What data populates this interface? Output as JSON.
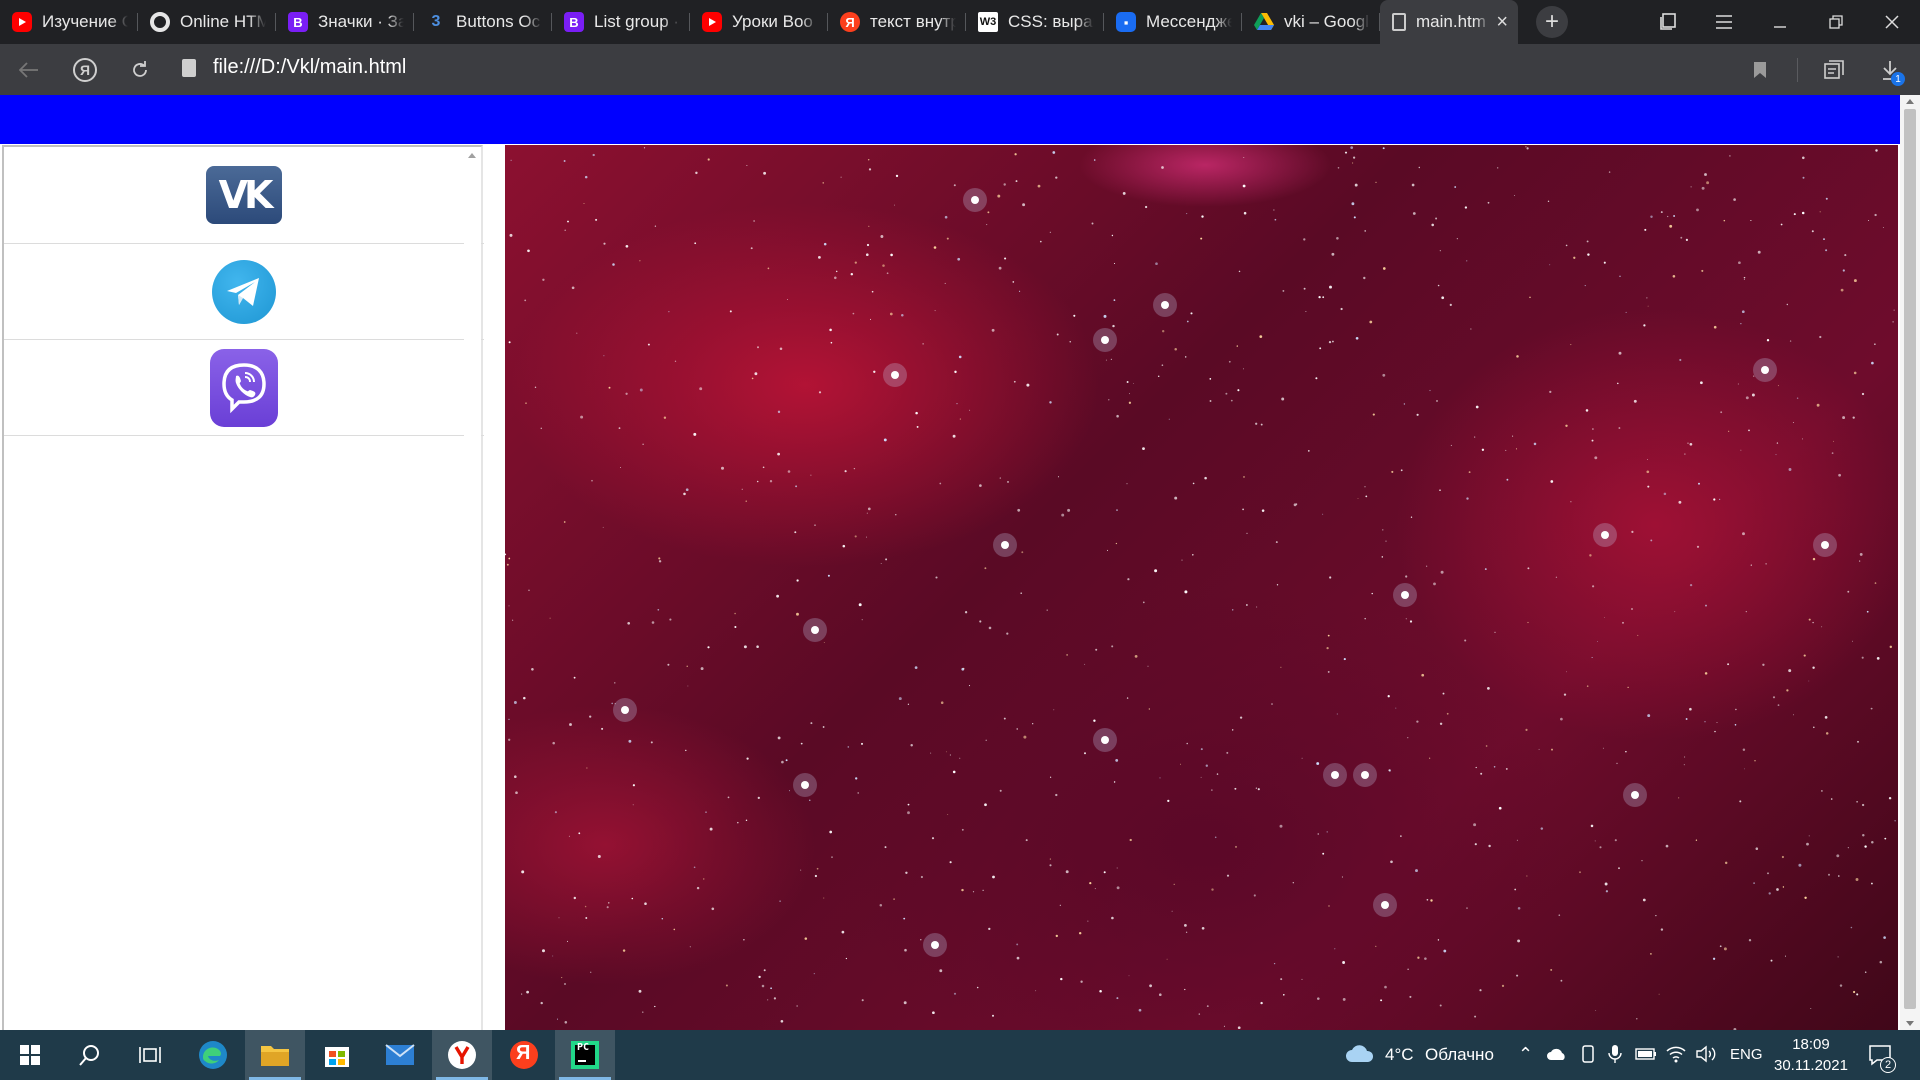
{
  "browser": {
    "tabs": [
      {
        "title": "Изучение С",
        "favicon": "youtube-icon"
      },
      {
        "title": "Online HTM",
        "favicon": "html-editor-icon"
      },
      {
        "title": "Значки · За",
        "favicon": "bootstrap-icon"
      },
      {
        "title": "Buttons Oc",
        "favicon": "css3-icon"
      },
      {
        "title": "List group ·",
        "favicon": "bootstrap-icon"
      },
      {
        "title": "Уроки Boo",
        "favicon": "youtube-icon"
      },
      {
        "title": "текст внутр",
        "favicon": "yandex-icon"
      },
      {
        "title": "CSS: вырав",
        "favicon": "w3schools-icon"
      },
      {
        "title": "Мессендже",
        "favicon": "messenger-icon"
      },
      {
        "title": "vki – Googl",
        "favicon": "google-drive-icon"
      },
      {
        "title": "main.htm",
        "favicon": "file-icon",
        "active": true
      }
    ],
    "new_tab_symbol": "+",
    "address": "file:///D:/Vkl/main.html",
    "download_badge": "1",
    "yandex_button_letter": "Я"
  },
  "page": {
    "header_color": "#0000ff",
    "social_list": [
      {
        "name": "vk",
        "glyph": "VK"
      },
      {
        "name": "telegram",
        "glyph": ""
      },
      {
        "name": "viber",
        "glyph": ""
      }
    ],
    "hero_image": "nebula-starfield"
  },
  "taskbar": {
    "weather_temp": "4°C",
    "weather_text": "Облачно",
    "language": "ENG",
    "time": "18:09",
    "date": "30.11.2021",
    "notification_count": "2",
    "yandex_letter": "Я",
    "pycharm_label": "PC"
  }
}
